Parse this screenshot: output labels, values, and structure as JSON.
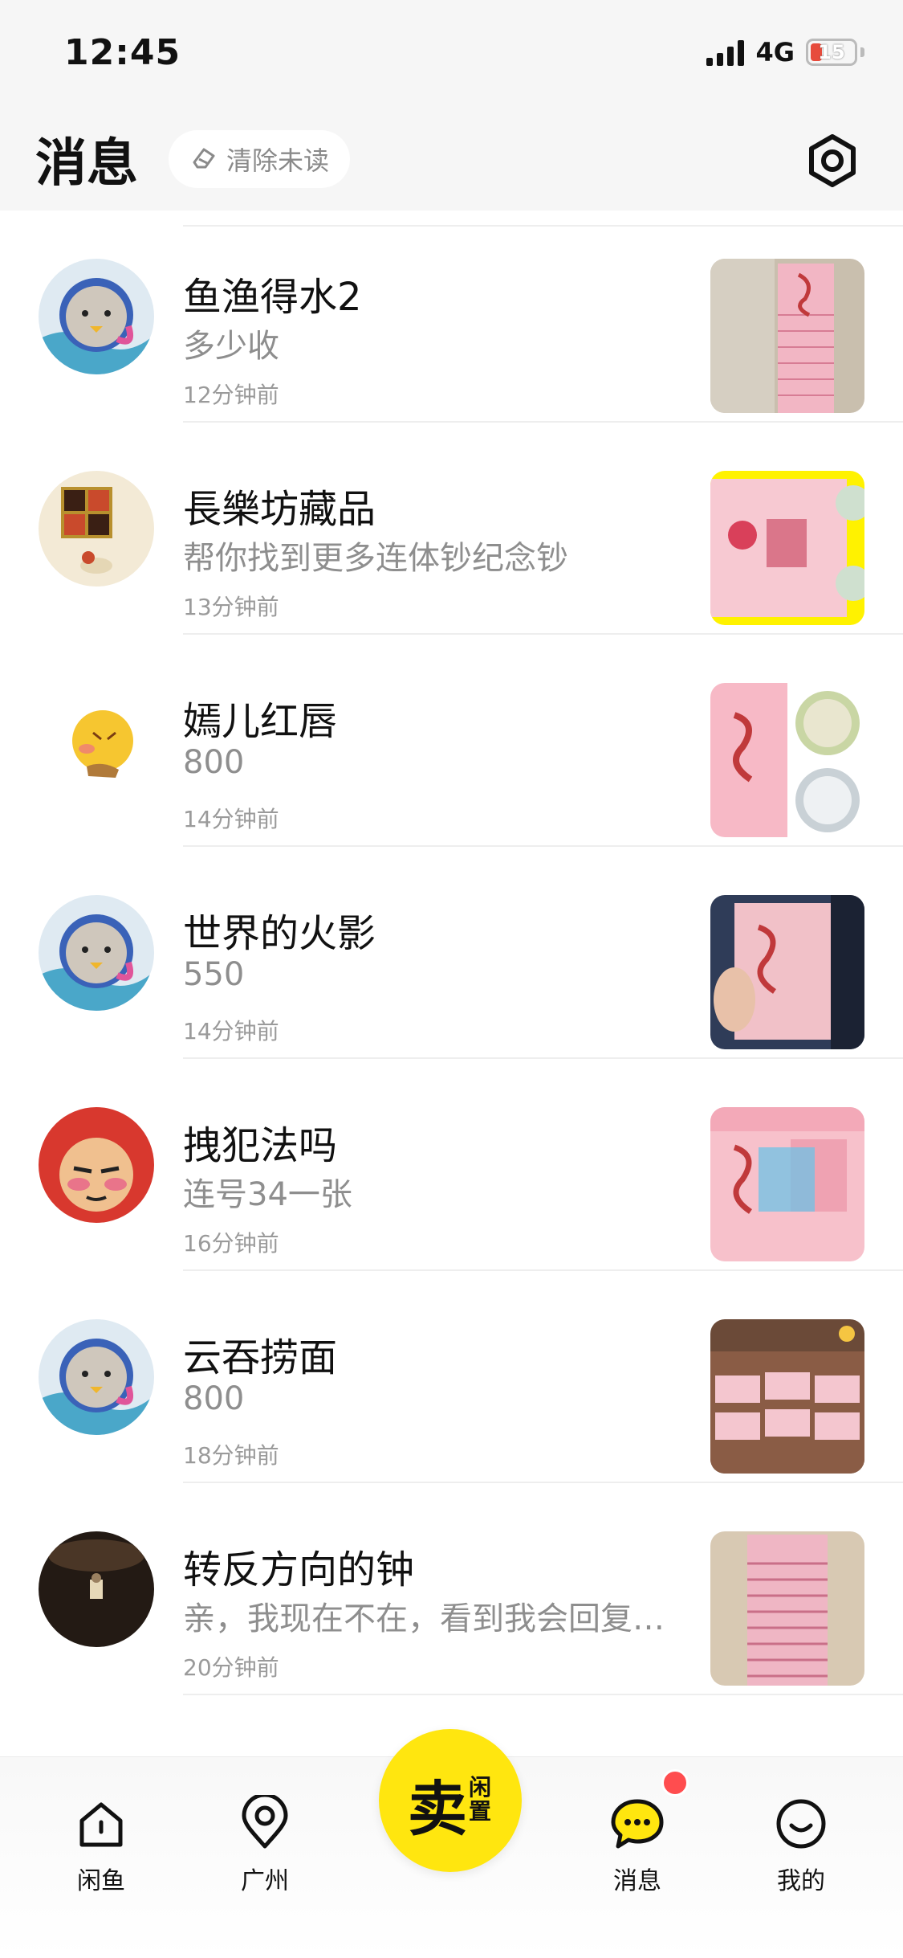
{
  "status_bar": {
    "time": "12:45",
    "network": "4G",
    "battery": "15"
  },
  "header": {
    "title": "消息",
    "clear_label": "清除未读"
  },
  "messages": [
    {
      "name": "鱼渔得水2",
      "preview": "多少收",
      "time": "12分钟前"
    },
    {
      "name": "長樂坊藏品",
      "preview": "帮你找到更多连体钞纪念钞",
      "time": "13分钟前"
    },
    {
      "name": "嫣儿红唇",
      "preview": "800",
      "time": "14分钟前"
    },
    {
      "name": "世界的火影",
      "preview": "550",
      "time": "14分钟前"
    },
    {
      "name": "拽犯法吗",
      "preview": "连号34一张",
      "time": "16分钟前"
    },
    {
      "name": "云吞捞面",
      "preview": "800",
      "time": "18分钟前"
    },
    {
      "name": "转反方向的钟",
      "preview": "亲，我现在不在，看到我会回复…",
      "time": "20分钟前"
    }
  ],
  "tabbar": {
    "home": "闲鱼",
    "local": "广州",
    "sell_big": "卖",
    "sell_small": "闲置",
    "messages": "消息",
    "mine": "我的"
  },
  "colors": {
    "accent": "#ffe60f",
    "badge": "#ff4d4f",
    "muted_text": "#8e8e8e"
  }
}
